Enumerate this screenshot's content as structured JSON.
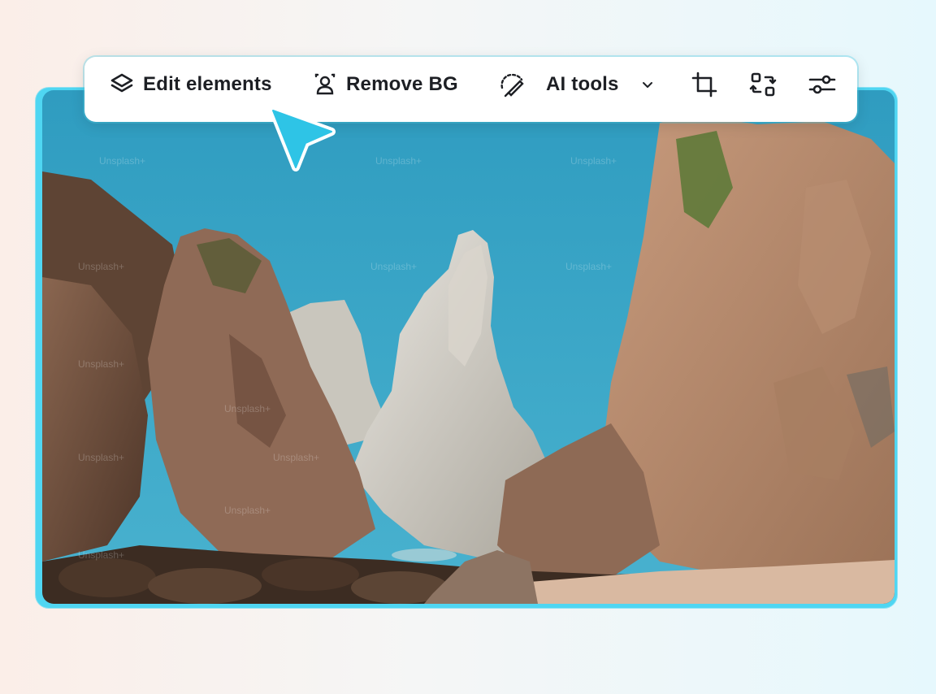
{
  "toolbar": {
    "edit_elements": {
      "label": "Edit elements",
      "icon": "layers-icon"
    },
    "remove_bg": {
      "label": "Remove BG",
      "icon": "person-outline-icon"
    },
    "ai_tools": {
      "label": "AI tools",
      "icon": "magic-brush-icon",
      "dropdown_icon": "chevron-down-icon"
    },
    "crop": {
      "icon": "crop-icon"
    },
    "swap": {
      "icon": "swap-icon"
    },
    "adjust": {
      "icon": "sliders-icon"
    }
  },
  "photo": {
    "description_icon": "photo",
    "watermark": "Unsplash+"
  },
  "colors": {
    "accent": "#4fd6f2",
    "cursor": "#2ec4e6",
    "text": "#1d1f24",
    "sky": "#3aa4c6"
  }
}
